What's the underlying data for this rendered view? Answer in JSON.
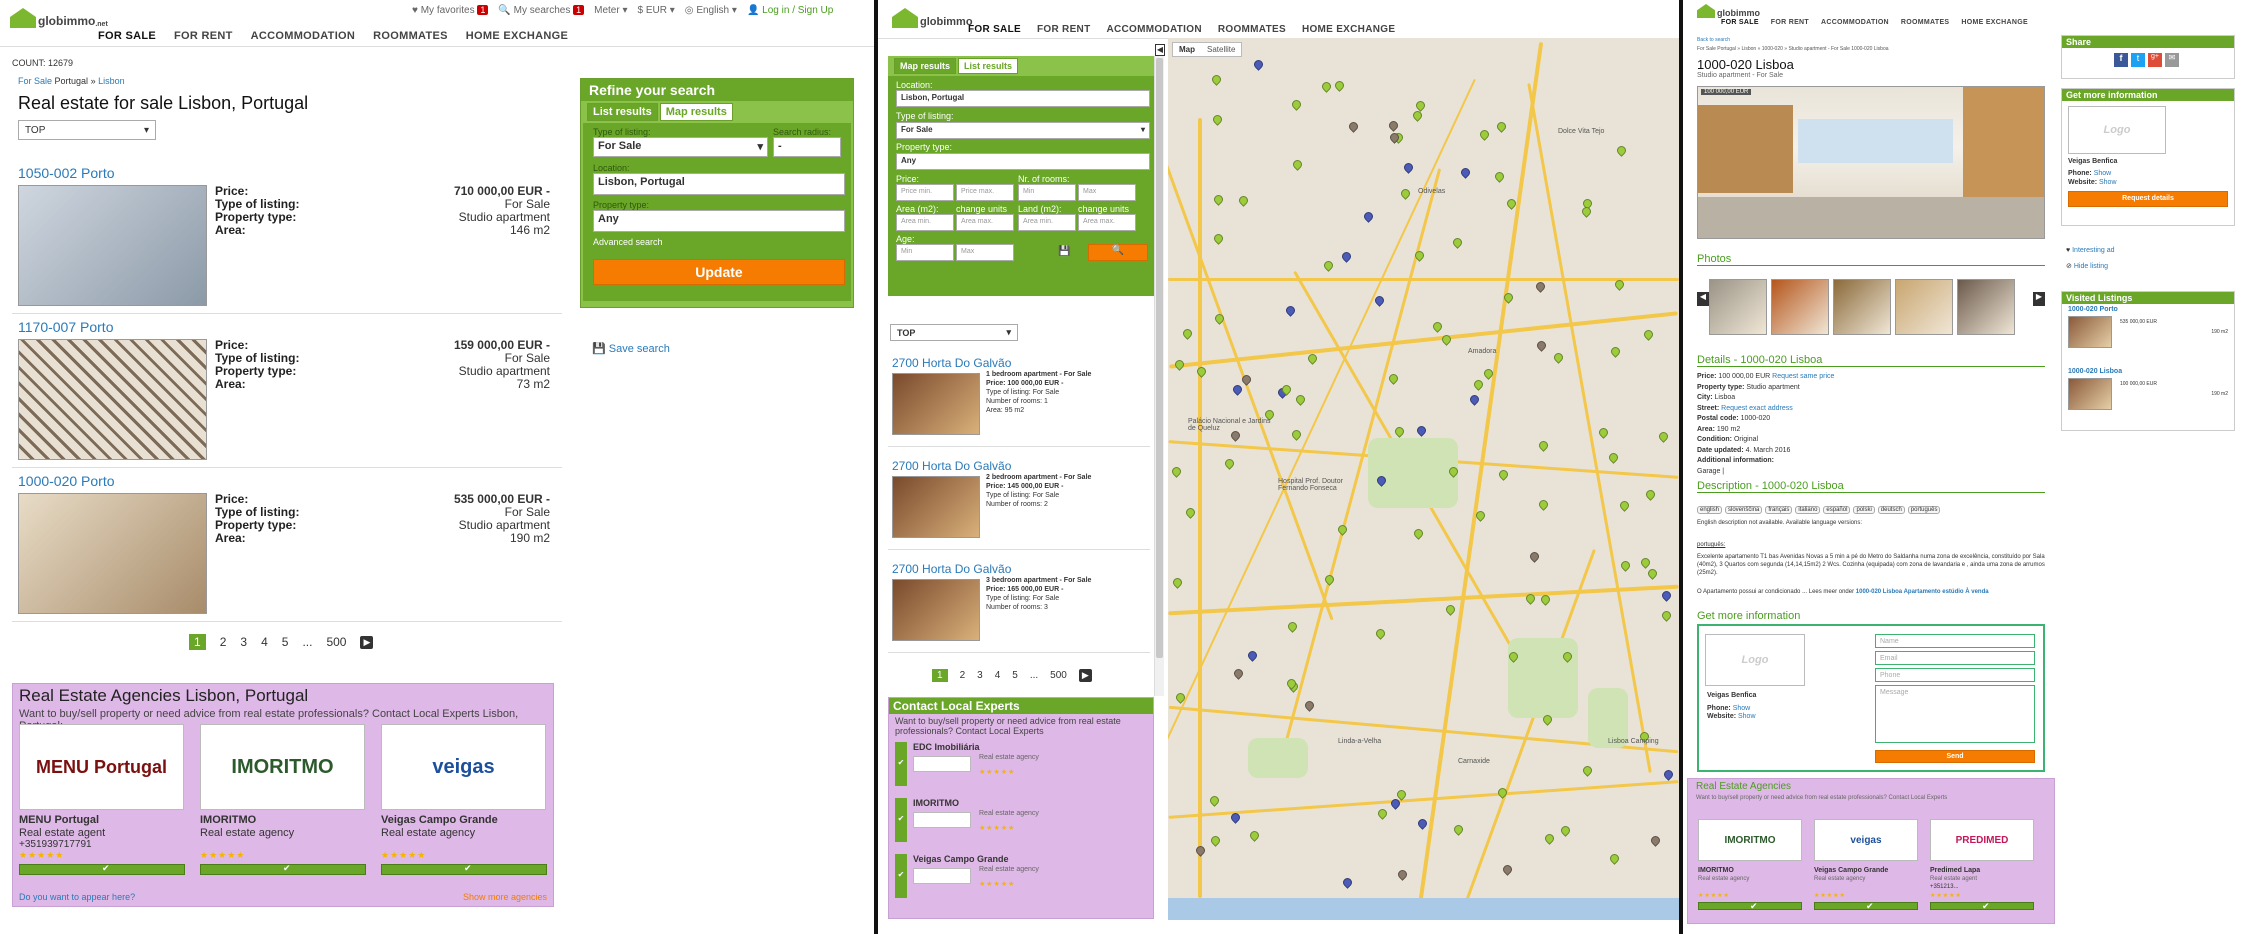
{
  "panel1": {
    "logo": "globimmo",
    "logo_suffix": ".net",
    "topbar": {
      "favorites": "My favorites",
      "fav_count": "1",
      "searches": "My searches",
      "search_count": "1",
      "unit": "Meter",
      "currency": "EUR",
      "language": "English",
      "login": "Log in / Sign Up"
    },
    "nav": [
      "FOR SALE",
      "FOR RENT",
      "ACCOMMODATION",
      "ROOMMATES",
      "HOME EXCHANGE"
    ],
    "count": "COUNT: 12679",
    "breadcrumb": [
      "For Sale",
      "Portugal",
      "»",
      "Lisbon"
    ],
    "title": "Real estate for sale Lisbon, Portugal",
    "sort": "TOP",
    "spec_labels": {
      "price": "Price:",
      "type": "Type of listing:",
      "property": "Property type:",
      "area": "Area:"
    },
    "listings": [
      {
        "title": "1050-002 Porto",
        "price": "710 000,00 EUR -",
        "type": "For Sale",
        "property": "Studio apartment",
        "area": "146 m2"
      },
      {
        "title": "1170-007 Porto",
        "price": "159 000,00 EUR -",
        "type": "For Sale",
        "property": "Studio apartment",
        "area": "73 m2"
      },
      {
        "title": "1000-020 Porto",
        "price": "535 000,00 EUR -",
        "type": "For Sale",
        "property": "Studio apartment",
        "area": "190 m2"
      }
    ],
    "pages": [
      "1",
      "2",
      "3",
      "4",
      "5",
      "...",
      "500"
    ],
    "refine": {
      "title": "Refine your search",
      "tab_list": "List results",
      "tab_map": "Map results",
      "type_label": "Type of listing:",
      "type_value": "For Sale",
      "radius_label": "Search radius:",
      "radius_value": "-",
      "location_label": "Location:",
      "location_value": "Lisbon, Portugal",
      "property_label": "Property type:",
      "property_value": "Any",
      "advanced": "Advanced search",
      "update": "Update",
      "save": "Save search"
    },
    "agencies": {
      "title": "Real Estate Agencies Lisbon, Portugal",
      "subtitle": "Want to buy/sell property or need advice from real estate professionals? Contact Local Experts Lisbon, Portugal:",
      "items": [
        {
          "name": "MENU Portugal",
          "role": "Real estate agent",
          "phone": "+351939717791",
          "logo": "MENU Portugal"
        },
        {
          "name": "IMORITMO",
          "role": "Real estate agency",
          "phone": "",
          "logo": "IMORITMO"
        },
        {
          "name": "Veigas Campo Grande",
          "role": "Real estate agency",
          "phone": "",
          "logo": "veigas"
        }
      ],
      "footer_left": "Do you want to appear here?",
      "footer_right": "Show more agencies"
    }
  },
  "panel2": {
    "logo": "globimmo",
    "nav": [
      "FOR SALE",
      "FOR RENT",
      "ACCOMMODATION",
      "ROOMMATES",
      "HOME EXCHANGE"
    ],
    "tab_map": "Map results",
    "tab_list": "List results",
    "location_label": "Location:",
    "location_value": "Lisbon, Portugal",
    "type_label": "Type of listing:",
    "type_value": "For Sale",
    "property_label": "Property type:",
    "property_value": "Any",
    "price_label": "Price:",
    "rooms_label": "Nr. of rooms:",
    "price_min": "Price min.",
    "price_max": "Price max.",
    "rooms_min": "Min",
    "rooms_max": "Max",
    "area_label": "Area (m2):",
    "land_label": "Land (m2):",
    "change_units": "change units",
    "area_min": "Area min.",
    "area_max": "Area max.",
    "age_label": "Age:",
    "age_min": "Min",
    "age_max": "Max",
    "sort": "TOP",
    "map_btn": "Map",
    "sat_btn": "Satellite",
    "listings": [
      {
        "title": "2700 Horta Do Galvão",
        "line1": "1 bedroom apartment - For Sale",
        "price": "Price: 100 000,00 EUR -",
        "type": "Type of listing: For Sale",
        "rooms": "Number of rooms: 1",
        "area": "Area: 95 m2"
      },
      {
        "title": "2700 Horta Do Galvão",
        "line1": "2 bedroom apartment - For Sale",
        "price": "Price: 145 000,00 EUR -",
        "type": "Type of listing: For Sale",
        "rooms": "Number of rooms: 2",
        "area": ""
      },
      {
        "title": "2700 Horta Do Galvão",
        "line1": "3 bedroom apartment - For Sale",
        "price": "Price: 165 000,00 EUR -",
        "type": "Type of listing: For Sale",
        "rooms": "Number of rooms: 3",
        "area": ""
      }
    ],
    "pages": [
      "1",
      "2",
      "3",
      "4",
      "5",
      "...",
      "500"
    ],
    "experts": {
      "title": "Contact Local Experts",
      "subtitle": "Want to buy/sell property or need advice from real estate professionals? Contact Local Experts",
      "items": [
        {
          "name": "EDC Imobiliária",
          "role": "Real estate agency"
        },
        {
          "name": "IMORITMO",
          "role": "Real estate agency"
        },
        {
          "name": "Veigas Campo Grande",
          "role": "Real estate agency"
        }
      ]
    },
    "map_labels": [
      "Amadora",
      "Odivelas",
      "Carnaxide",
      "Linda-a-Velha",
      "Hospital Prof. Doutor Fernando Fonseca",
      "Palácio Nacional e Jardins de Queluz",
      "Dolce Vita Tejo",
      "Lisboa Camping"
    ]
  },
  "panel3": {
    "logo": "globimmo",
    "nav": [
      "FOR SALE",
      "FOR RENT",
      "ACCOMMODATION",
      "ROOMMATES",
      "HOME EXCHANGE"
    ],
    "back": "Back to search",
    "breadcrumb": "For Sale Portugal » Lisbon » 1000-020 » Studio apartment - For Sale 1000-020 Lisboa",
    "title": "1000-020 Lisboa",
    "subtitle": "Studio apartment - For Sale",
    "price_tag": "100 000,00 EUR",
    "photos_title": "Photos",
    "details_title": "Details - 1000-020 Lisboa",
    "details": [
      {
        "k": "Price:",
        "v": "100 000,00 EUR",
        "extra": "Request same price"
      },
      {
        "k": "Property type:",
        "v": "Studio apartment",
        "extra": ""
      },
      {
        "k": "City:",
        "v": "Lisboa",
        "extra": ""
      },
      {
        "k": "Street:",
        "v": "",
        "extra": "Request exact address"
      },
      {
        "k": "Postal code:",
        "v": "1000-020",
        "extra": ""
      },
      {
        "k": "Area:",
        "v": "190 m2",
        "extra": ""
      },
      {
        "k": "Condition:",
        "v": "Original",
        "extra": ""
      },
      {
        "k": "Date updated:",
        "v": "4. March 2016",
        "extra": ""
      },
      {
        "k": "Additional information:",
        "v": "",
        "extra": ""
      }
    ],
    "garage": "Garage |",
    "desc_title": "Description - 1000-020 Lisboa",
    "langs": [
      "english",
      "slovenščina",
      "français",
      "italiano",
      "español",
      "polski",
      "deutsch",
      "português"
    ],
    "desc_note": "English description not available. Available language versions:",
    "desc_lang": "português:",
    "desc_text": "Excelente apartamento T1 bas Avenidas Novas a 5 min a pé do Metro do Saldanha numa zona de excelência, constituído por Sala (40m2), 3 Quartos com segunda (14,14,15m2) 2 Wcs. Cozinha (equipada) com zona de lavandaria e , ainda uma zona de arrumos (25m2).",
    "desc_more": "O Apartamento possui ar condicionado ... Lees meer onder",
    "desc_link": "1000-020 Lisboa Apartamento estúdio À venda",
    "contact_title": "Get more information",
    "contact_fields": [
      "Name",
      "Email",
      "Phone",
      "Message"
    ],
    "send": "Send",
    "agent_name": "Veigas Benfica",
    "phone_label": "Phone:",
    "phone_val": "Show",
    "website_label": "Website:",
    "website_val": "Show",
    "logo_ph": "Logo",
    "share": "Share",
    "more_info": "Get more information",
    "request": "Request details",
    "interesting": "Interesting ad",
    "hide": "Hide listing",
    "visited": "Visited Listings",
    "visited_items": [
      {
        "title": "1000-020 Porto",
        "price": "535 000,00 EUR",
        "area": "190 m2"
      },
      {
        "title": "1000-020 Lisboa",
        "price": "100 000,00 EUR",
        "area": "190 m2"
      }
    ],
    "agencies_title": "Real Estate Agencies",
    "agencies_sub": "Want to buy/sell property or need advice from real estate professionals? Contact Local Experts",
    "agencies": [
      {
        "name": "IMORITMO",
        "role": "Real estate agency",
        "logo": "IMORITMO"
      },
      {
        "name": "Veigas Campo Grande",
        "role": "Real estate agency",
        "logo": "veigas"
      },
      {
        "name": "Predimed Lapa",
        "role": "Real estate agent",
        "phone": "+351213...",
        "logo": "PREDIMED"
      }
    ]
  }
}
